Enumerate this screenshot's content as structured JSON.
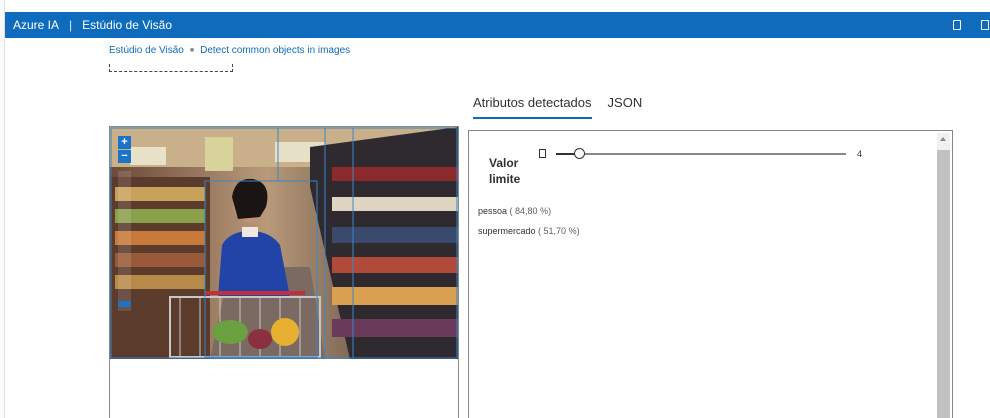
{
  "header": {
    "brand": "Azure IA",
    "separator": "|",
    "title": "Estúdio de Visão"
  },
  "breadcrumb": {
    "home": "Estúdio de Visão",
    "current": "Detect common objects in images"
  },
  "tabs": [
    {
      "label": "Atributos detectados",
      "active": true
    },
    {
      "label": "JSON",
      "active": false
    }
  ],
  "image_panel": {
    "zoom_in": "+",
    "zoom_out": "−"
  },
  "threshold": {
    "label_line1": "Valor",
    "label_line2": "limite",
    "value": "4",
    "slider_fraction": 0.08
  },
  "results": [
    {
      "name": "pessoa",
      "confidence": "( 84,80 %)"
    },
    {
      "name": "supermercado",
      "confidence": "( 51,70 %)"
    }
  ],
  "colors": {
    "accent": "#0f6cbd",
    "bounding_box": "#3a86c8"
  }
}
